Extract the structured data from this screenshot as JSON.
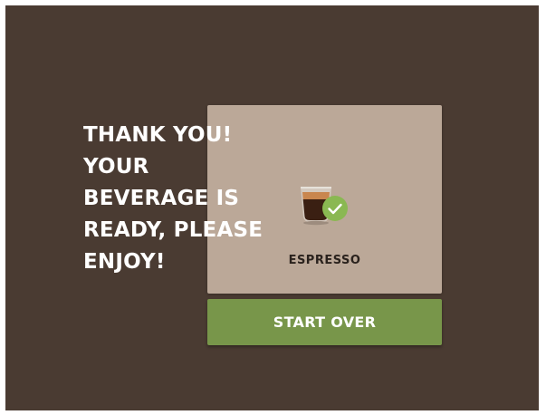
{
  "confirmation": {
    "message_lines": [
      "THANK YOU!",
      "YOUR",
      "BEVERAGE IS",
      "READY, PLEASE",
      "ENJOY!"
    ]
  },
  "product": {
    "name": "ESPRESSO",
    "icon": "espresso-cup-icon",
    "status_icon": "checkmark-icon"
  },
  "actions": {
    "start_over_label": "START OVER"
  },
  "colors": {
    "background": "#4a3b32",
    "card": "#bba898",
    "button": "#78964a",
    "check_badge": "#8ab852"
  }
}
